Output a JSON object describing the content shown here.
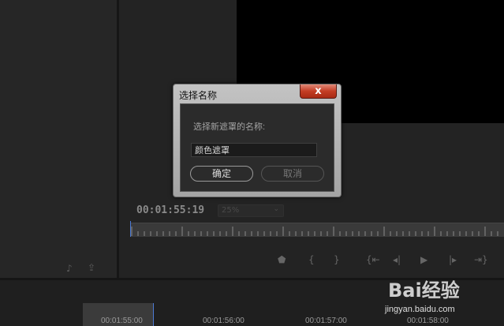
{
  "monitor": {
    "timecode": "00:01:55:19",
    "zoom": "25%"
  },
  "transport_icons": [
    "marker-icon",
    "mark-in-icon",
    "mark-out-icon",
    "go-to-in-icon",
    "step-back-icon",
    "play-icon",
    "step-forward-icon",
    "go-to-out-icon"
  ],
  "timeline": {
    "labels": [
      "00:01:55:00",
      "00:01:56:00",
      "00:01:57:00",
      "00:01:58:00"
    ]
  },
  "dialog": {
    "title": "选择名称",
    "close_label": "x",
    "prompt": "选择新遮罩的名称:",
    "input_value": "颜色遮罩",
    "ok_label": "确定",
    "cancel_label": "取消"
  },
  "watermark": {
    "logo_text": "Bai经验",
    "url": "jingyan.baidu.com"
  },
  "colors": {
    "panel_bg": "#262626",
    "video_bg": "#000000",
    "playhead": "#4c7ad4",
    "close_button": "#c33d24"
  }
}
